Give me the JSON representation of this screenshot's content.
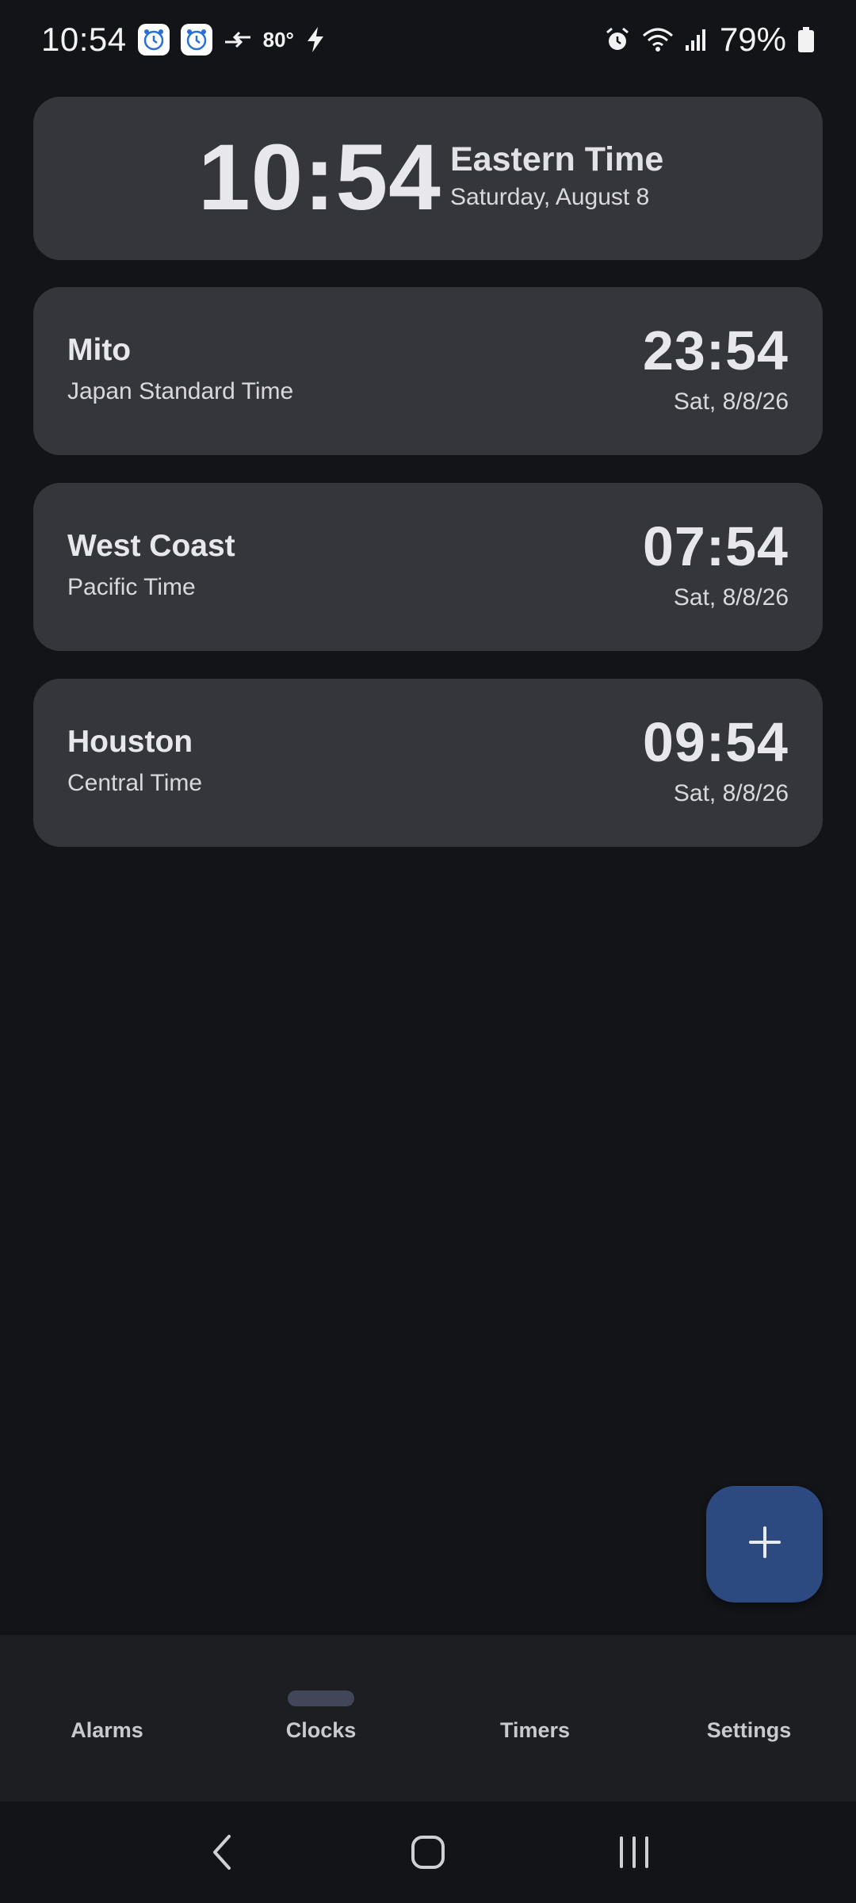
{
  "status_bar": {
    "time": "10:54",
    "temperature": "80°",
    "battery": "79%",
    "icons_left": [
      "alarm-clock-notif-icon",
      "alarm-clock-notif-icon",
      "data-transfer-icon",
      "charging-bolt-icon"
    ],
    "icons_right": [
      "alarm-icon",
      "wifi-icon",
      "signal-icon",
      "battery-icon"
    ]
  },
  "local_clock": {
    "time": "10:54",
    "zone": "Eastern Time",
    "date": "Saturday, August 8"
  },
  "world_clocks": [
    {
      "city": "Mito",
      "zone": "Japan Standard Time",
      "time": "23:54",
      "date": "Sat, 8/8/26"
    },
    {
      "city": "West Coast",
      "zone": "Pacific Time",
      "time": "07:54",
      "date": "Sat, 8/8/26"
    },
    {
      "city": "Houston",
      "zone": "Central Time",
      "time": "09:54",
      "date": "Sat, 8/8/26"
    }
  ],
  "fab": {
    "icon": "plus-icon"
  },
  "bottom_nav": {
    "active": "Clocks",
    "items": [
      {
        "label": "Alarms"
      },
      {
        "label": "Clocks"
      },
      {
        "label": "Timers"
      },
      {
        "label": "Settings"
      }
    ]
  },
  "system_nav": [
    "back-icon",
    "home-icon",
    "recents-icon"
  ],
  "colors": {
    "background": "#131418",
    "card": "#35363b",
    "fab": "#2c4a80",
    "nav_bar": "#1d1e22",
    "nav_indicator": "#414658"
  }
}
